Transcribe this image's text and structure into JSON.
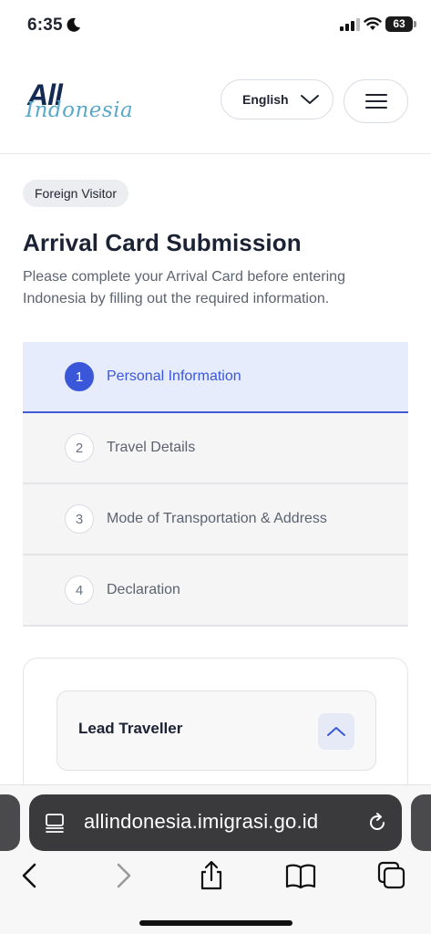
{
  "status_bar": {
    "time": "6:35",
    "battery": "63"
  },
  "header": {
    "logo_all": "All",
    "logo_indonesia": "Indonesia",
    "language": "English"
  },
  "main": {
    "badge": "Foreign Visitor",
    "title": "Arrival Card Submission",
    "description": "Please complete your Arrival Card before entering Indonesia by filling out the required information.",
    "steps": [
      {
        "num": "1",
        "label": "Personal Information"
      },
      {
        "num": "2",
        "label": "Travel Details"
      },
      {
        "num": "3",
        "label": "Mode of Transportation & Address"
      },
      {
        "num": "4",
        "label": "Declaration"
      }
    ],
    "lead_traveller": "Lead Traveller"
  },
  "browser": {
    "url": "allindonesia.imigrasi.go.id"
  },
  "colors": {
    "accent": "#3b57d9",
    "active_step_bg": "#e6ecfc"
  }
}
